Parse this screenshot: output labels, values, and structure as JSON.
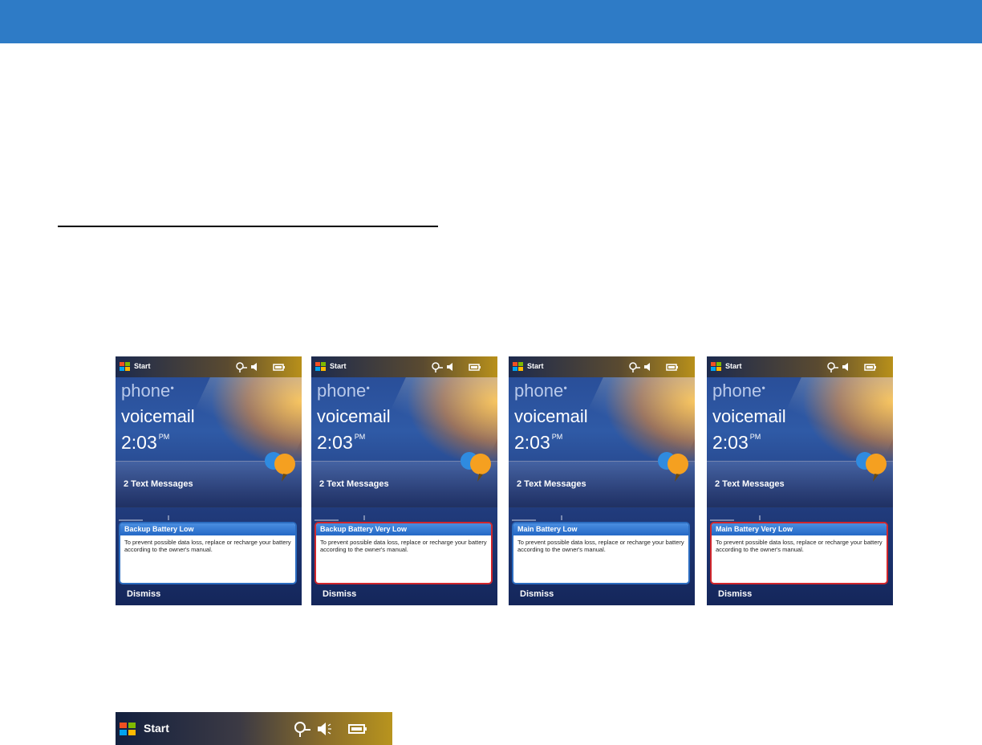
{
  "colors": {
    "header_bar": "#2e7bc6",
    "rule": "#000000",
    "dialog_border_normal": "#2b6cc0",
    "dialog_border_alert": "#d0262c"
  },
  "screens": [
    {
      "start": "Start",
      "phone": "phone",
      "voicemail": "voicemail",
      "time": "2:03",
      "ampm": "PM",
      "messages": "2 Text Messages",
      "dialog_title": "Backup Battery Low",
      "dialog_text": "To prevent possible data loss, replace or recharge your battery according to the owner's manual.",
      "dismiss": "Dismiss",
      "dialog_style": "normal"
    },
    {
      "start": "Start",
      "phone": "phone",
      "voicemail": "voicemail",
      "time": "2:03",
      "ampm": "PM",
      "messages": "2 Text Messages",
      "dialog_title": "Backup Battery Very Low",
      "dialog_text": "To prevent possible data loss, replace or recharge your battery according to the owner's manual.",
      "dismiss": "Dismiss",
      "dialog_style": "alert"
    },
    {
      "start": "Start",
      "phone": "phone",
      "voicemail": "voicemail",
      "time": "2:03",
      "ampm": "PM",
      "messages": "2 Text Messages",
      "dialog_title": "Main Battery Low",
      "dialog_text": "To prevent possible data loss, replace or recharge your battery according to the owner's manual.",
      "dismiss": "Dismiss",
      "dialog_style": "normal"
    },
    {
      "start": "Start",
      "phone": "phone",
      "voicemail": "voicemail",
      "time": "2:03",
      "ampm": "PM",
      "messages": "2 Text Messages",
      "dialog_title": "Main Battery Very Low",
      "dialog_text": "To prevent possible data loss, replace or recharge your battery according to the owner's manual.",
      "dismiss": "Dismiss",
      "dialog_style": "alert"
    }
  ],
  "taskbar": {
    "start": "Start",
    "icons": [
      "windows-logo-icon",
      "connectivity-icon",
      "speaker-icon",
      "battery-icon"
    ]
  }
}
